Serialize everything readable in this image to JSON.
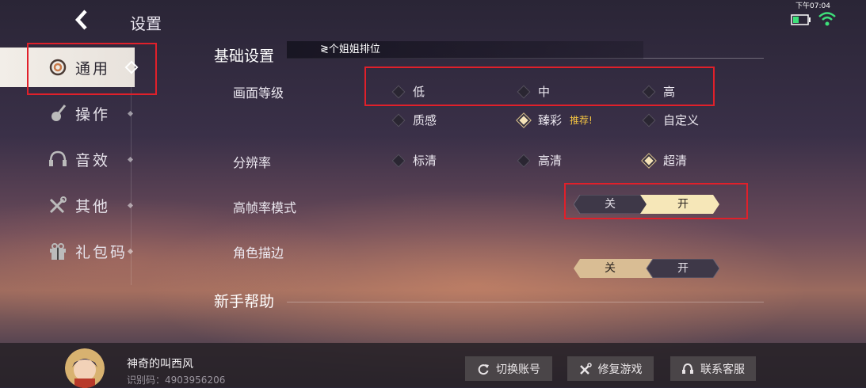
{
  "header": {
    "title": "设置",
    "time": "下午07:04"
  },
  "sidebar": {
    "items": [
      {
        "label": "通用",
        "icon": "general-icon",
        "active": true
      },
      {
        "label": "操作",
        "icon": "control-icon"
      },
      {
        "label": "音效",
        "icon": "headphone-icon"
      },
      {
        "label": "其他",
        "icon": "tools-icon"
      },
      {
        "label": "礼包码",
        "icon": "gift-icon"
      }
    ]
  },
  "main": {
    "section_basic": "基础设置",
    "tooltip": "≷个姐姐排位",
    "graphics": {
      "label": "画面等级",
      "options": [
        "低",
        "中",
        "高",
        "质感",
        "臻彩",
        "自定义"
      ],
      "selected": "臻彩",
      "badge": "推荐!"
    },
    "resolution": {
      "label": "分辨率",
      "options": [
        "标清",
        "高清",
        "超清"
      ],
      "selected": "超清"
    },
    "high_fps": {
      "label": "高帧率模式",
      "off": "关",
      "on": "开",
      "value": "开"
    },
    "outline": {
      "label": "角色描边",
      "off": "关",
      "on": "开",
      "value": "关"
    },
    "section_help": "新手帮助"
  },
  "footer": {
    "player_name": "神奇的叫西风",
    "player_id": "识别码：4903956206",
    "switch_account": "切换账号",
    "repair_game": "修复游戏",
    "contact_service": "联系客服"
  },
  "colors": {
    "highlight": "#e0202a",
    "accent": "#f5e3b8",
    "badge": "#f5c542"
  }
}
